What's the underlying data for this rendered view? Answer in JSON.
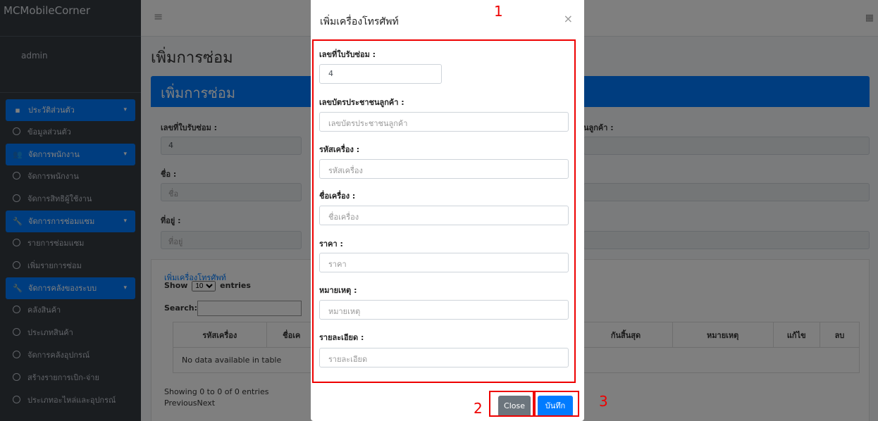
{
  "brand": "MCMobileCorner",
  "user": "admin",
  "nav": [
    {
      "label": "ประวัติส่วนตัว",
      "type": "group",
      "icon": "id-card-icon"
    },
    {
      "label": "ข้อมูลส่วนตัว",
      "type": "item"
    },
    {
      "label": "จัดการพนักงาน",
      "type": "group",
      "icon": "users-icon"
    },
    {
      "label": "จัดการพนักงาน",
      "type": "item"
    },
    {
      "label": "จัดการสิทธิผู้ใช้งาน",
      "type": "item"
    },
    {
      "label": "จัดการการซ่อมแซม",
      "type": "group",
      "icon": "wrench-icon"
    },
    {
      "label": "รายการซ่อมแซม",
      "type": "item"
    },
    {
      "label": "เพิ่มรายการซ่อม",
      "type": "item"
    },
    {
      "label": "จัดการคลังของระบบ",
      "type": "group",
      "icon": "wrench-icon"
    },
    {
      "label": "คลังสินค้า",
      "type": "item"
    },
    {
      "label": "ประเภทสินค้า",
      "type": "item"
    },
    {
      "label": "จัดการคลังอุปกรณ์",
      "type": "item"
    },
    {
      "label": "สร้างรายการเบิก-จ่าย",
      "type": "item"
    },
    {
      "label": "ประเภทอะไหล่และอุปกรณ์",
      "type": "item"
    }
  ],
  "page": {
    "title": "เพิ่มการซ่อม",
    "card_title": "เพิ่มการซ่อม",
    "receipt_label": "เลขที่ใบรับซ่อม :",
    "receipt_value": "4",
    "customer_id_label_partial": "นลูกค้า :",
    "name_label": "ชื่อ :",
    "name_placeholder": "ชื่อ",
    "address_label": "ที่อยู่ :",
    "address_placeholder": "ที่อยู่"
  },
  "table": {
    "add_link": "เพิ่มเครื่องโทรศัพท์",
    "show_label": "Show",
    "show_value": "10",
    "entries_label": "entries",
    "search_label": "Search:",
    "headers": [
      "รหัสเครื่อง",
      "ชื่อเค",
      "",
      "",
      "กันสิ้นสุด",
      "หมายเหตุ",
      "แก้ไข",
      "ลบ"
    ],
    "empty_text": "No data available in table",
    "info": "Showing 0 to 0 of 0 entries",
    "pager": "PreviousNext"
  },
  "modal": {
    "title": "เพิ่มเครื่องโทรศัพท์",
    "close_x": "×",
    "fields": [
      {
        "label": "เลขที่ใบรับซ่อม :",
        "value": "4",
        "placeholder": ""
      },
      {
        "label": "เลขบัตรประชาชนลูกค้า :",
        "value": "",
        "placeholder": "เลขบัตรประชาชนลูกค้า"
      },
      {
        "label": "รหัสเครื่อง :",
        "value": "",
        "placeholder": "รหัสเครื่อง"
      },
      {
        "label": "ชื่อเครื่อง :",
        "value": "",
        "placeholder": "ชื่อเครื่อง"
      },
      {
        "label": "ราคา :",
        "value": "",
        "placeholder": "ราคา"
      },
      {
        "label": "หมายเหตุ :",
        "value": "",
        "placeholder": "หมายเหตุ"
      },
      {
        "label": "รายละเอียด :",
        "value": "",
        "placeholder": "รายละเอียด"
      }
    ],
    "close_button": "Close",
    "save_button": "บันทึก"
  },
  "annotations": [
    "1",
    "2",
    "3"
  ],
  "colors": {
    "primary": "#007bff",
    "sidebar": "#343a40",
    "annotation": "#ee0000"
  }
}
